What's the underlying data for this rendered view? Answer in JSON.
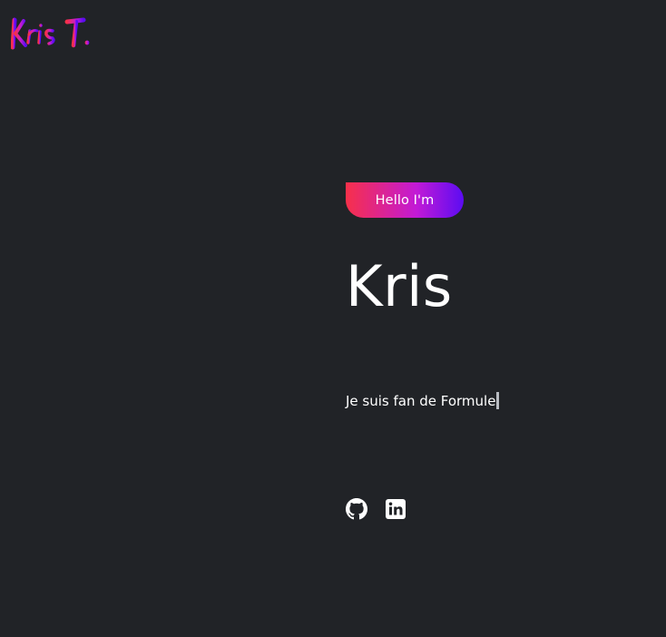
{
  "header": {
    "logo_text": "Kris T.",
    "logo_gradient": [
      "#f7304a",
      "#c21ad6",
      "#5b0cf2"
    ]
  },
  "hero": {
    "badge_label": "Hello I'm",
    "name": "Kris",
    "typed_text": "Je suis fan de Formule"
  },
  "socials": [
    {
      "icon": "github-icon"
    },
    {
      "icon": "linkedin-icon"
    }
  ],
  "colors": {
    "background": "#212327",
    "text": "#ffffff",
    "cursor": "#b9bcc2"
  }
}
